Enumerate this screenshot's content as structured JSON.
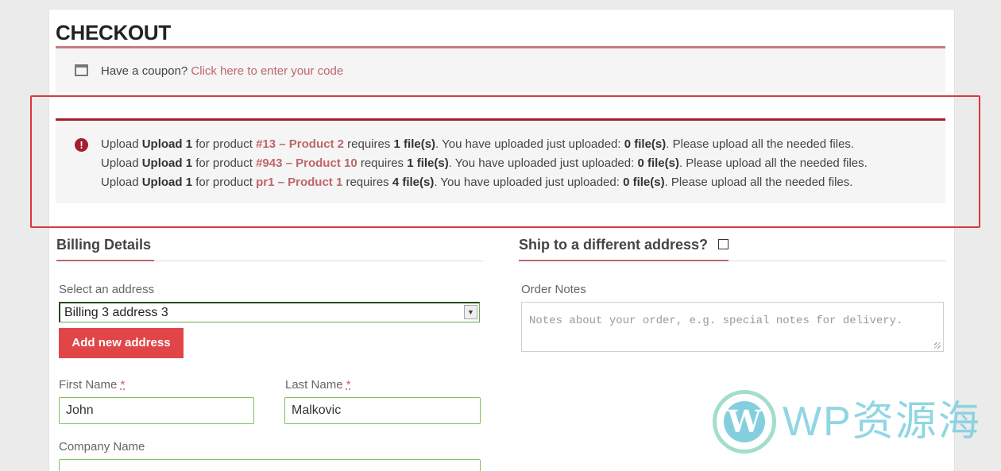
{
  "page": {
    "title": "CHECKOUT"
  },
  "coupon": {
    "text": "Have a coupon?",
    "link": "Click here to enter your code"
  },
  "errors": [
    {
      "p1": "Upload ",
      "upload": "Upload 1",
      "p2": " for product ",
      "product": "#13 – Product 2",
      "p3": " requires ",
      "req": "1 file(s)",
      "p4": ". You have uploaded just uploaded: ",
      "up": "0 file(s)",
      "p5": ". Please upload all the needed files."
    },
    {
      "p1": "Upload ",
      "upload": "Upload 1",
      "p2": " for product ",
      "product": "#943 – Product 10",
      "p3": " requires ",
      "req": "1 file(s)",
      "p4": ". You have uploaded just uploaded: ",
      "up": "0 file(s)",
      "p5": ". Please upload all the needed files."
    },
    {
      "p1": "Upload ",
      "upload": "Upload 1",
      "p2": " for product ",
      "product": "pr1 – Product 1",
      "p3": " requires ",
      "req": "4 file(s)",
      "p4": ". You have uploaded just uploaded: ",
      "up": "0 file(s)",
      "p5": ". Please upload all the needed files."
    }
  ],
  "billing": {
    "heading": "Billing Details",
    "select_label": "Select an address",
    "select_value": "Billing 3 address 3",
    "add_button": "Add new address",
    "first_name_label": "First Name",
    "first_name_value": "John",
    "last_name_label": "Last Name",
    "last_name_value": "Malkovic",
    "required_mark": "*",
    "company_label": "Company Name"
  },
  "shipping": {
    "heading": "Ship to a different address?",
    "notes_label": "Order Notes",
    "notes_placeholder": "Notes about your order, e.g. special notes for delivery."
  },
  "watermark": {
    "text": "WP资源海",
    "logo_letter": "W"
  },
  "colors": {
    "accent": "#c0656b",
    "error": "#a51e2d",
    "button": "#e24548",
    "highlight": "#d93a3a"
  }
}
